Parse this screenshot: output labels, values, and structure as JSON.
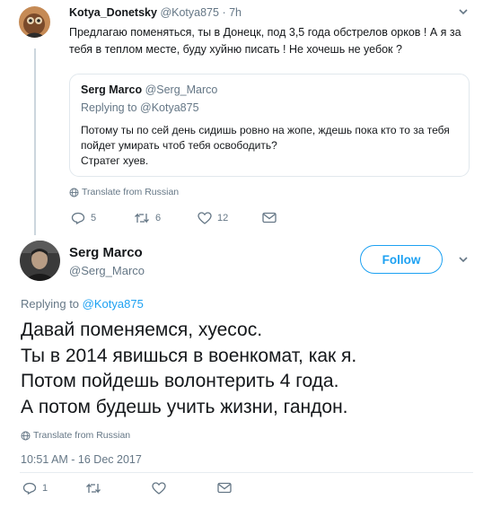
{
  "reply_tweet": {
    "author_name": "Kotya_Donetsky",
    "author_handle": "@Kotya875",
    "separator": "·",
    "time": "7h",
    "text": "Предлагаю поменяться, ты в Донецк, под  3,5 года обстрелов орков ! А я за тебя в теплом месте, буду хуйню писать ! Не хочешь не уебок ?",
    "quoted": {
      "author_name": "Serg Marco",
      "author_handle": "@Serg_Marco",
      "replying_prefix": "Replying to",
      "replying_to": "@Kotya875",
      "lines": [
        "Потому ты по сей день сидишь ровно на жопе, ждешь пока кто то за тебя пойдет умирать чтоб тебя освободить?",
        "Стратег хуев."
      ]
    },
    "translate_label": "Translate from Russian",
    "counts": {
      "replies": "5",
      "retweets": "6",
      "likes": "12"
    }
  },
  "main_tweet": {
    "author_name": "Serg Marco",
    "author_handle": "@Serg_Marco",
    "follow_label": "Follow",
    "replying_prefix": "Replying to",
    "replying_to": "@Kotya875",
    "lines": [
      "Давай поменяемся, хуесос.",
      "Ты в 2014 явишься в военкомат, как я.",
      "Потом пойдешь волонтерить 4 года.",
      "А потом будешь учить жизни, гандон."
    ],
    "translate_label": "Translate from Russian",
    "timestamp": "10:51 AM - 16 Dec 2017",
    "counts": {
      "replies": "1"
    }
  },
  "colors": {
    "accent": "#1da1f2",
    "muted": "#657786",
    "border": "#e1e8ed",
    "text": "#14171a"
  },
  "icons": [
    "reply-icon",
    "retweet-icon",
    "like-icon",
    "direct-message-icon",
    "globe-icon",
    "chevron-down-icon"
  ]
}
